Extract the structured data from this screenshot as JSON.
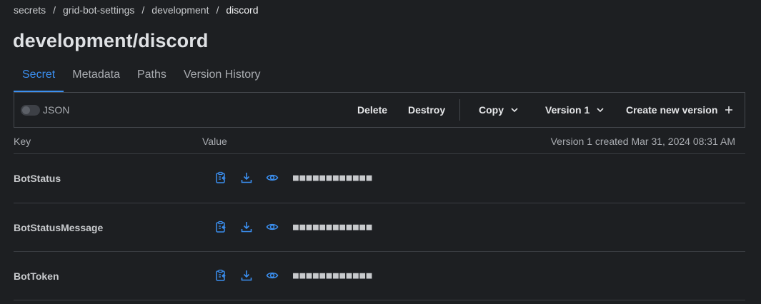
{
  "breadcrumb": {
    "items": [
      "secrets",
      "grid-bot-settings",
      "development",
      "discord"
    ],
    "separator": "/"
  },
  "title": "development/discord",
  "tabs": [
    {
      "label": "Secret",
      "active": true
    },
    {
      "label": "Metadata",
      "active": false
    },
    {
      "label": "Paths",
      "active": false
    },
    {
      "label": "Version History",
      "active": false
    }
  ],
  "toolbar": {
    "json_label": "JSON",
    "json_enabled": false,
    "delete_label": "Delete",
    "destroy_label": "Destroy",
    "copy_label": "Copy",
    "version_label": "Version 1",
    "create_label": "Create new version"
  },
  "table": {
    "key_header": "Key",
    "value_header": "Value",
    "version_info": "Version 1 created Mar 31, 2024 08:31 AM",
    "rows": [
      {
        "key": "BotStatus",
        "masked_value": "■■■■■■■■■■■■"
      },
      {
        "key": "BotStatusMessage",
        "masked_value": "■■■■■■■■■■■■"
      },
      {
        "key": "BotToken",
        "masked_value": "■■■■■■■■■■■■"
      }
    ]
  },
  "colors": {
    "background": "#1d1f22",
    "accent": "#3b8ff0",
    "border": "#45484d",
    "muted_text": "#a9acb1"
  },
  "icons": [
    "toggle-switch",
    "chevron-down-icon",
    "plus-icon",
    "clipboard-copy-icon",
    "download-icon",
    "eye-icon"
  ]
}
